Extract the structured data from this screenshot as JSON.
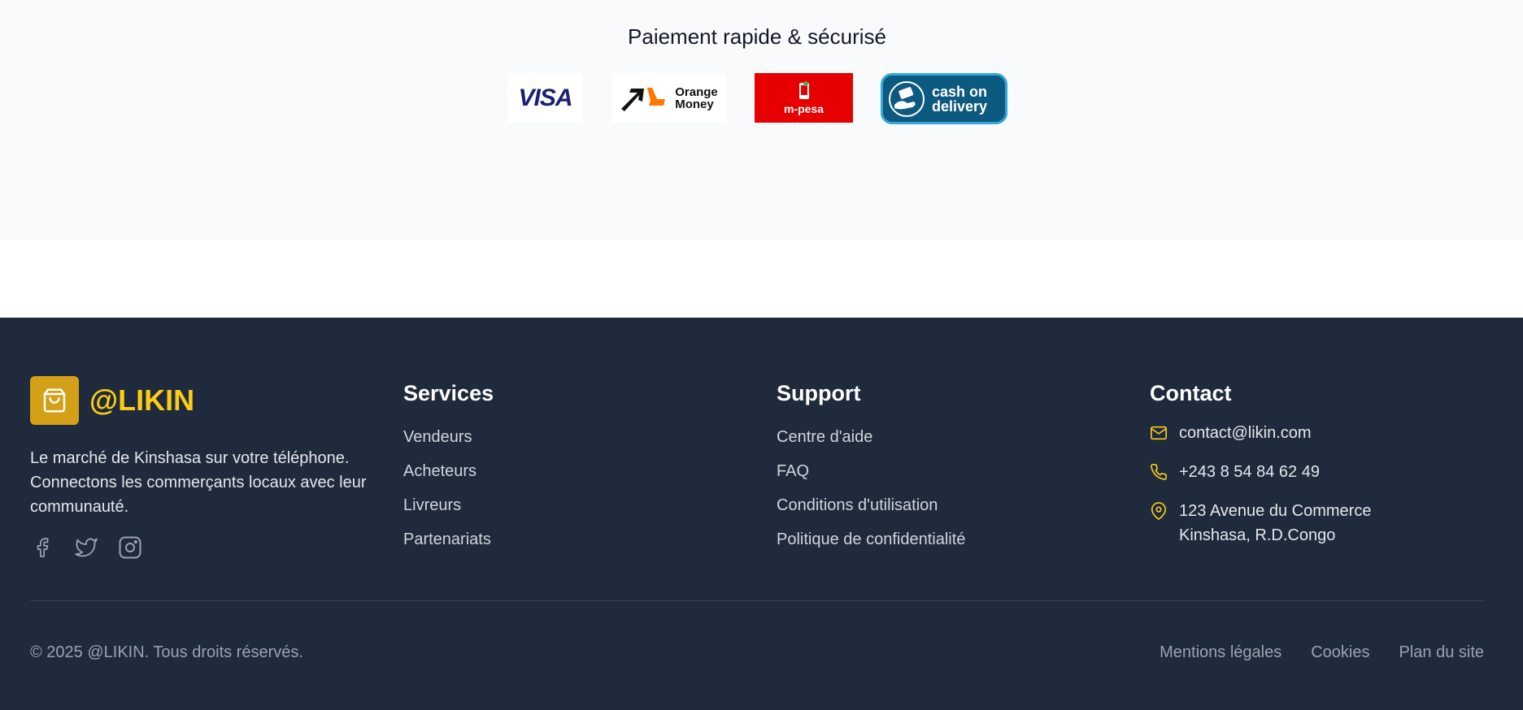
{
  "payment": {
    "title": "Paiement rapide & sécurisé",
    "logos": {
      "visa": "VISA",
      "orange_money_line1": "Orange",
      "orange_money_line2": "Money",
      "mpesa": "m-pesa",
      "cod_line1": "cash on",
      "cod_line2": "delivery"
    }
  },
  "footer": {
    "brand": {
      "name": "@LIKIN",
      "description": "Le marché de Kinshasa sur votre téléphone. Connectons les commerçants locaux avec leur communauté."
    },
    "social": [
      "facebook-icon",
      "twitter-icon",
      "instagram-icon"
    ],
    "services": {
      "title": "Services",
      "links": [
        "Vendeurs",
        "Acheteurs",
        "Livreurs",
        "Partenariats"
      ]
    },
    "support": {
      "title": "Support",
      "links": [
        "Centre d'aide",
        "FAQ",
        "Conditions d'utilisation",
        "Politique de confidentialité"
      ]
    },
    "contact": {
      "title": "Contact",
      "email": "contact@likin.com",
      "phone": "+243 8 54 84 62 49",
      "address_line1": "123 Avenue du Commerce",
      "address_line2": "Kinshasa, R.D.Congo"
    },
    "copyright": "© 2025 @LIKIN. Tous droits réservés.",
    "legal": [
      "Mentions légales",
      "Cookies",
      "Plan du site"
    ]
  },
  "colors": {
    "accent": "#facc15",
    "brand_box": "#d4a017",
    "footer_bg": "#1f2a3c",
    "section_bg": "#f9fafb"
  }
}
